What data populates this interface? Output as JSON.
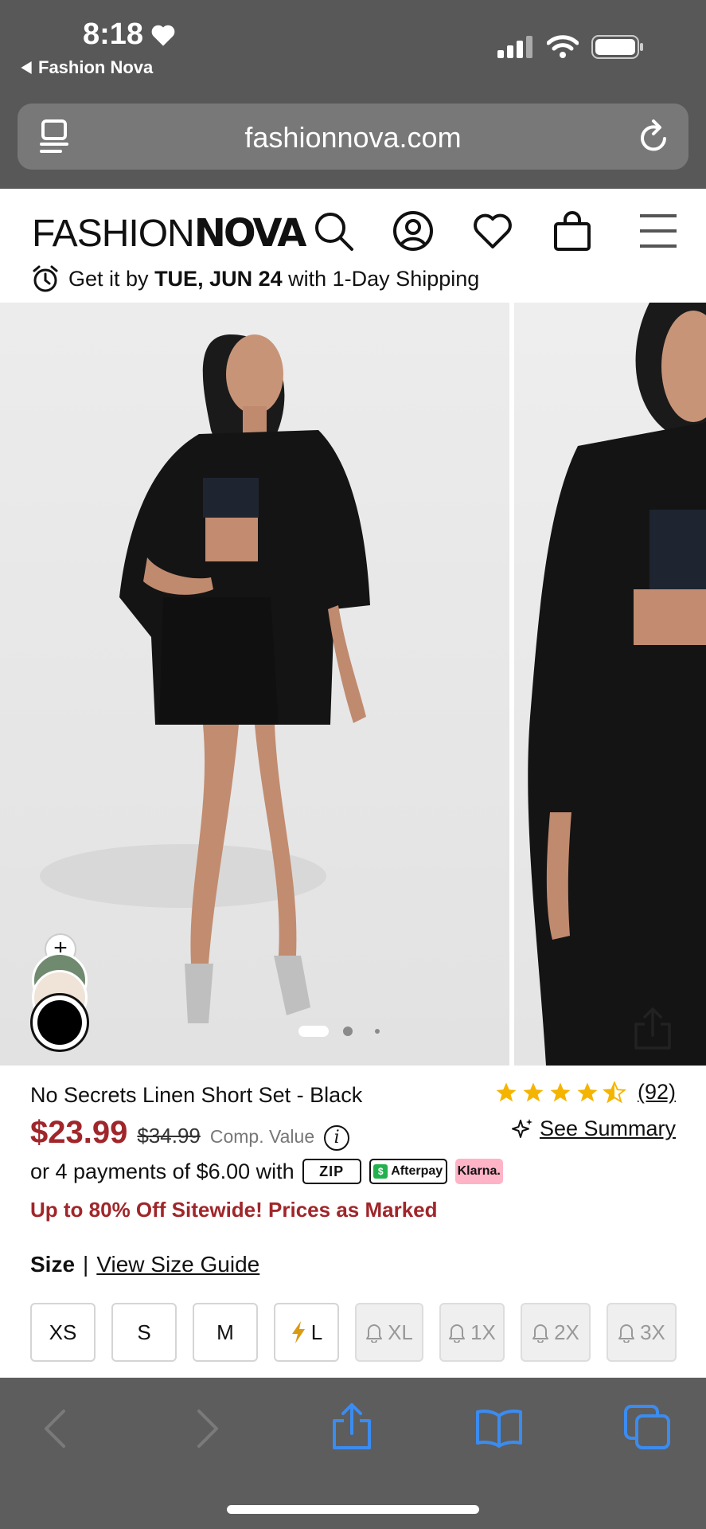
{
  "status": {
    "time": "8:18",
    "back_app": "Fashion Nova"
  },
  "browser": {
    "url": "fashionnova.com"
  },
  "header": {
    "logo_light": "FASHION",
    "logo_bold": "NOVA",
    "shipping_prefix": "Get it by",
    "shipping_date": "TUE, JUN 24",
    "shipping_suffix": "with 1-Day Shipping"
  },
  "product": {
    "name": "No Secrets Linen Short Set - Black",
    "rating": 4.5,
    "review_count": "(92)",
    "price": "$23.99",
    "old_price": "$34.99",
    "comp_label": "Comp. Value",
    "info_glyph": "i",
    "summary_label": "See Summary",
    "installments": "or 4 payments of $6.00 with",
    "zip_label": "ZIP",
    "afterpay_label": "Afterpay",
    "klarna_label": "Klarna.",
    "promo": "Up to 80% Off Sitewide! Prices as Marked",
    "size_label": "Size",
    "size_sep": "|",
    "size_guide": "View Size Guide",
    "swatch_add": "+",
    "swatches": [
      {
        "name": "sage",
        "color": "#6f8a6f"
      },
      {
        "name": "cream",
        "color": "#efe4d7"
      },
      {
        "name": "black",
        "color": "#000000",
        "selected": true
      }
    ],
    "sizes": [
      {
        "label": "XS",
        "available": true,
        "icon": ""
      },
      {
        "label": "S",
        "available": true,
        "icon": ""
      },
      {
        "label": "M",
        "available": true,
        "icon": ""
      },
      {
        "label": "L",
        "available": true,
        "icon": "lightning"
      },
      {
        "label": "XL",
        "available": false,
        "icon": "bell"
      },
      {
        "label": "1X",
        "available": false,
        "icon": "bell"
      },
      {
        "label": "2X",
        "available": false,
        "icon": "bell"
      },
      {
        "label": "3X",
        "available": false,
        "icon": "bell"
      }
    ],
    "carousel": {
      "current": 1,
      "total": 3
    }
  },
  "colors": {
    "accent_red": "#a0262a",
    "star": "#f5b400",
    "safari_blue": "#3b8cf0"
  }
}
